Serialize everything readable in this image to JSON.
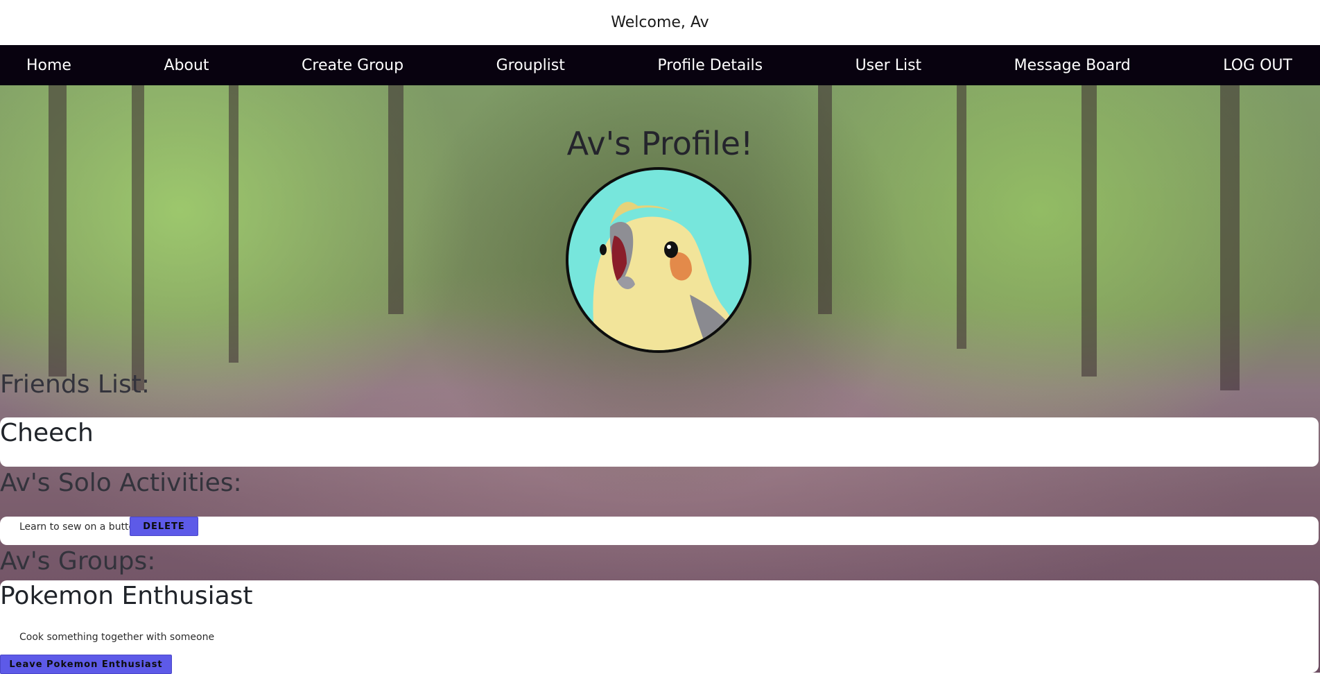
{
  "header": {
    "welcome": "Welcome, Av"
  },
  "nav": {
    "items": [
      {
        "label": "Home"
      },
      {
        "label": "About"
      },
      {
        "label": "Create Group"
      },
      {
        "label": "Grouplist"
      },
      {
        "label": "Profile Details"
      },
      {
        "label": "User List"
      },
      {
        "label": "Message Board"
      },
      {
        "label": "LOG OUT"
      }
    ]
  },
  "profile": {
    "title": "Av's Profile!",
    "avatar_alt": "cockatiel-avatar"
  },
  "friends": {
    "heading": "Friends List:",
    "items": [
      {
        "name": "Cheech"
      }
    ]
  },
  "solo_activities": {
    "heading": "Av's Solo Activities:",
    "items": [
      {
        "text": "Learn to sew on a button",
        "delete_label": "DELETE"
      }
    ]
  },
  "groups": {
    "heading": "Av's Groups:",
    "items": [
      {
        "name": "Pokemon Enthusiast",
        "activity": "Cook something together with someone",
        "leave_label": "Leave Pokemon Enthusiast"
      }
    ]
  },
  "colors": {
    "nav_bg": "#08020f",
    "button_bg": "#5d5ae8",
    "avatar_bg": "#77e6dc"
  }
}
